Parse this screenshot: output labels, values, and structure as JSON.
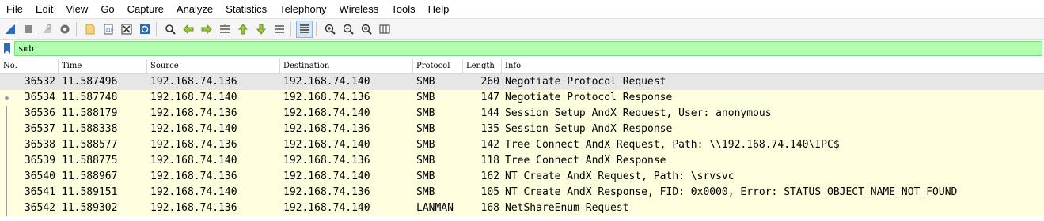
{
  "menu": [
    "File",
    "Edit",
    "View",
    "Go",
    "Capture",
    "Analyze",
    "Statistics",
    "Telephony",
    "Wireless",
    "Tools",
    "Help"
  ],
  "toolbar": {
    "buttons": [
      "shark-fin-icon",
      "stop-icon",
      "restart-icon",
      "options-gear-icon",
      "open-file-icon",
      "save-file-icon",
      "close-file-icon",
      "reload-icon",
      "find-icon",
      "back-arrow-icon",
      "forward-arrow-icon",
      "goto-packet-icon",
      "first-packet-icon",
      "last-packet-icon",
      "autoscroll-icon",
      "colorize-icon",
      "zoom-in-icon",
      "zoom-out-icon",
      "zoom-normal-icon",
      "resize-columns-icon"
    ]
  },
  "filter": {
    "value": "smb",
    "color": "#afffaf"
  },
  "columns": [
    "No.",
    "Time",
    "Source",
    "Destination",
    "Protocol",
    "Length",
    "Info"
  ],
  "packets": [
    {
      "no": "36532",
      "time": "11.587496",
      "src": "192.168.74.136",
      "dst": "192.168.74.140",
      "proto": "SMB",
      "len": "260",
      "info": "Negotiate Protocol Request"
    },
    {
      "no": "36534",
      "time": "11.587748",
      "src": "192.168.74.140",
      "dst": "192.168.74.136",
      "proto": "SMB",
      "len": "147",
      "info": "Negotiate Protocol Response"
    },
    {
      "no": "36536",
      "time": "11.588179",
      "src": "192.168.74.136",
      "dst": "192.168.74.140",
      "proto": "SMB",
      "len": "144",
      "info": "Session Setup AndX Request, User: anonymous"
    },
    {
      "no": "36537",
      "time": "11.588338",
      "src": "192.168.74.140",
      "dst": "192.168.74.136",
      "proto": "SMB",
      "len": "135",
      "info": "Session Setup AndX Response"
    },
    {
      "no": "36538",
      "time": "11.588577",
      "src": "192.168.74.136",
      "dst": "192.168.74.140",
      "proto": "SMB",
      "len": "142",
      "info": "Tree Connect AndX Request, Path: \\\\192.168.74.140\\IPC$"
    },
    {
      "no": "36539",
      "time": "11.588775",
      "src": "192.168.74.140",
      "dst": "192.168.74.136",
      "proto": "SMB",
      "len": "118",
      "info": "Tree Connect AndX Response"
    },
    {
      "no": "36540",
      "time": "11.588967",
      "src": "192.168.74.136",
      "dst": "192.168.74.140",
      "proto": "SMB",
      "len": "162",
      "info": "NT Create AndX Request, Path: \\srvsvc"
    },
    {
      "no": "36541",
      "time": "11.589151",
      "src": "192.168.74.140",
      "dst": "192.168.74.136",
      "proto": "SMB",
      "len": "105",
      "info": "NT Create AndX Response, FID: 0x0000, Error: STATUS_OBJECT_NAME_NOT_FOUND"
    },
    {
      "no": "36542",
      "time": "11.589302",
      "src": "192.168.74.136",
      "dst": "192.168.74.140",
      "proto": "LANMAN",
      "len": "168",
      "info": "NetShareEnum Request"
    }
  ],
  "colors": {
    "row_bg": "#ffffe0",
    "selected_bg": "#e6e6e6",
    "accent": "#1f5fb5"
  }
}
